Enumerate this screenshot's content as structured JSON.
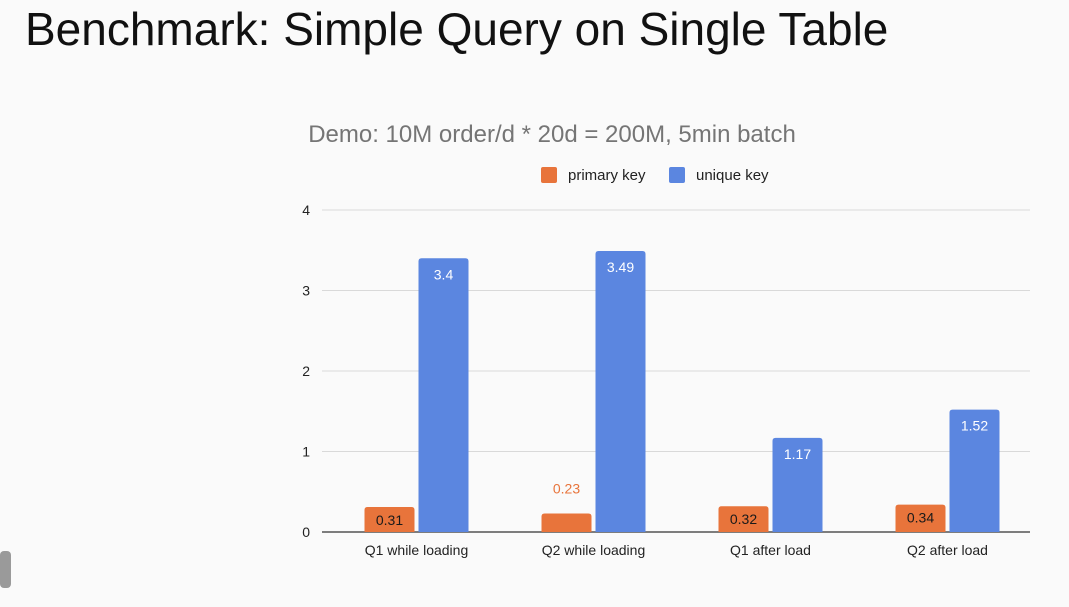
{
  "slide": {
    "title": "Benchmark: Simple Query on Single Table"
  },
  "colors": {
    "primary_key": "#e8743b",
    "unique_key": "#5b86e0",
    "grid": "#d9d9d9",
    "axis": "#333333",
    "label_orange_outside": "#e8743b"
  },
  "chart_data": {
    "type": "bar",
    "title": "Demo: 10M order/d * 20d = 200M, 5min batch",
    "xlabel": "",
    "ylabel": "",
    "ylim": [
      0,
      4
    ],
    "yticks": [
      0,
      1,
      2,
      3,
      4
    ],
    "grid": true,
    "legend": "top",
    "categories": [
      "Q1 while loading",
      "Q2 while loading",
      "Q1 after load",
      "Q2 after load"
    ],
    "series": [
      {
        "name": "primary key",
        "values": [
          0.31,
          0.23,
          0.32,
          0.34
        ]
      },
      {
        "name": "unique key",
        "values": [
          3.4,
          3.49,
          1.17,
          1.52
        ]
      }
    ],
    "data_labels": [
      [
        "0.31",
        "0.23",
        "0.32",
        "0.34"
      ],
      [
        "3.4",
        "3.49",
        "1.17",
        "1.52"
      ]
    ]
  }
}
